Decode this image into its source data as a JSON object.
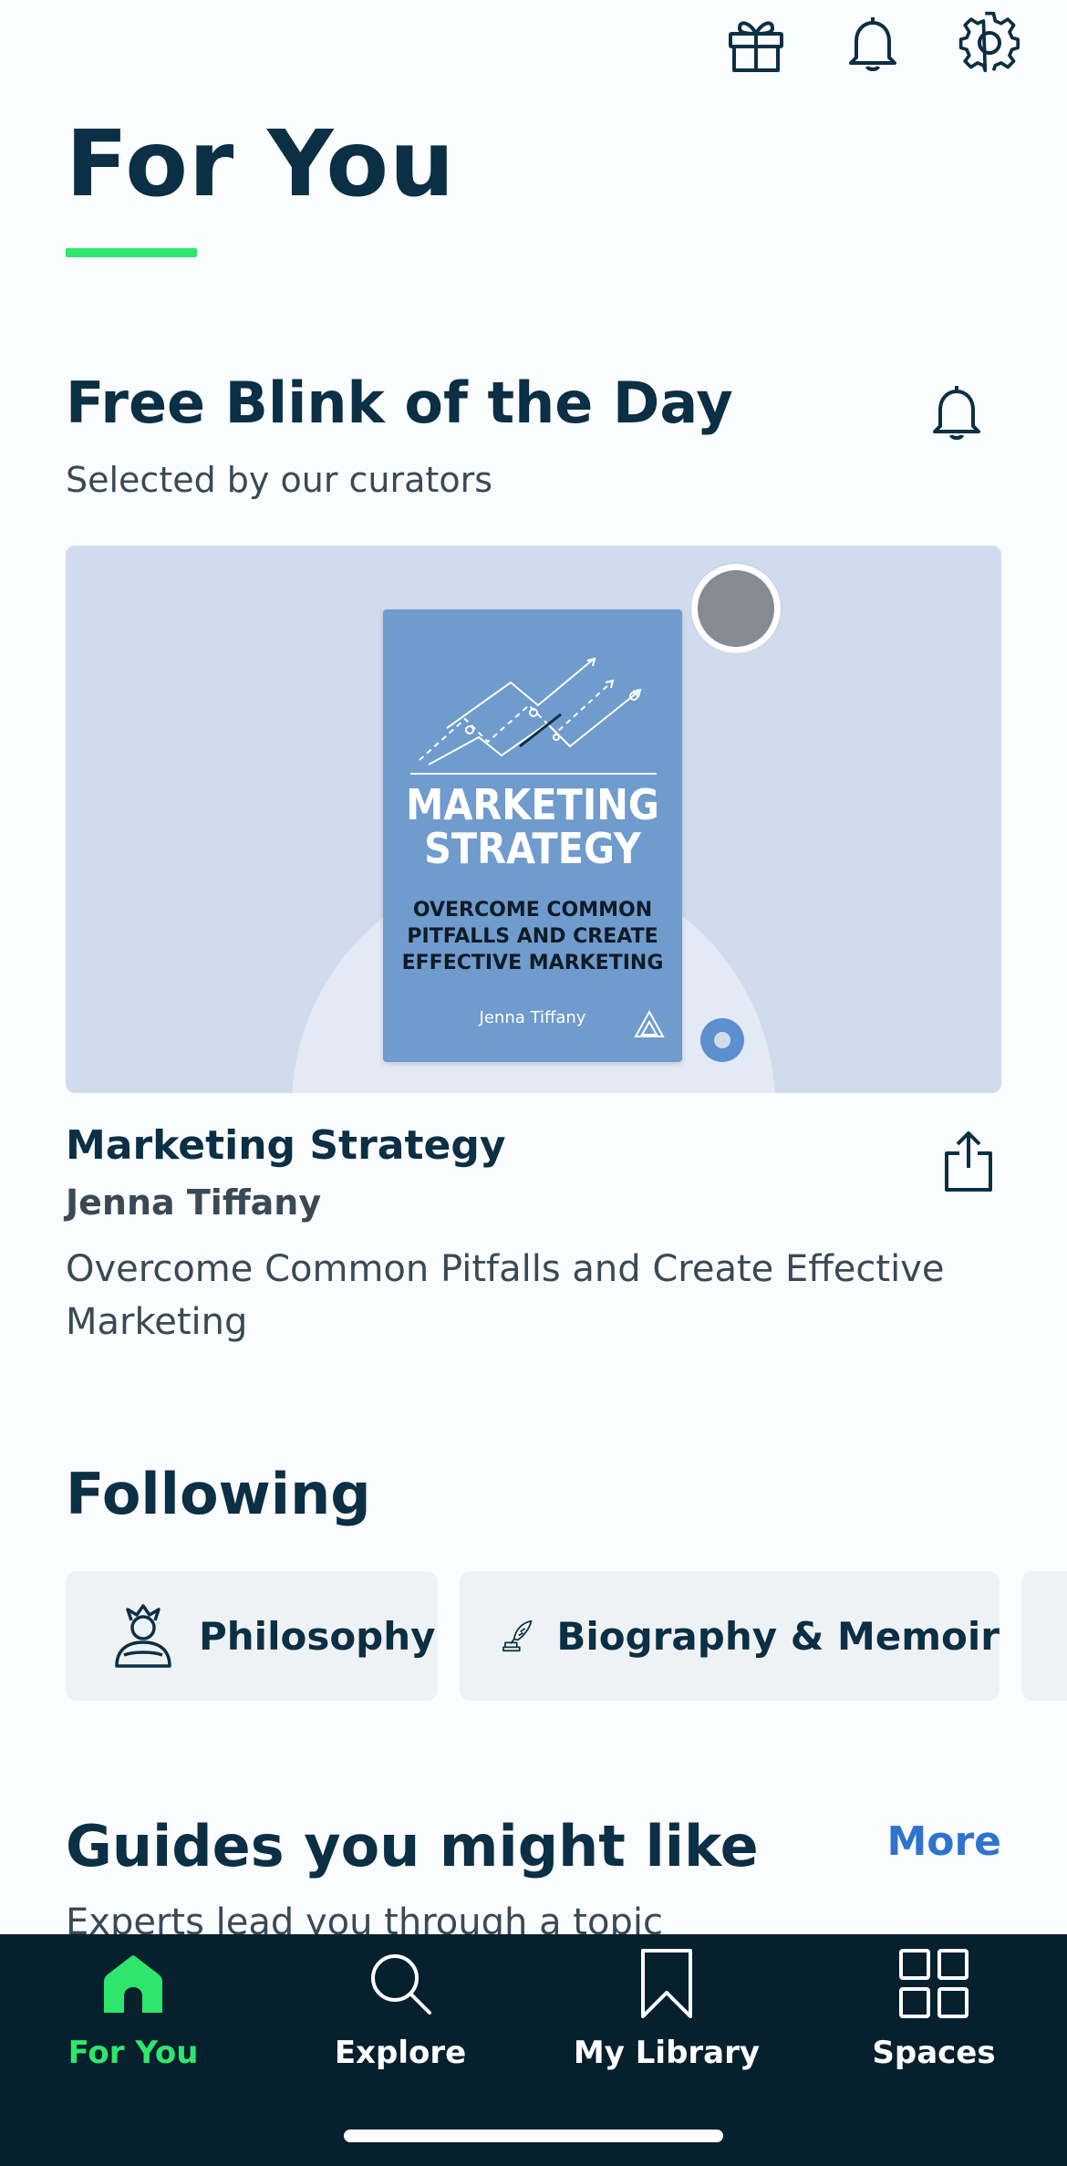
{
  "header": {
    "title": "For You",
    "icons": [
      "gift-icon",
      "bell-icon",
      "gear-icon"
    ]
  },
  "blink_of_day": {
    "title": "Free Blink of the Day",
    "subtitle": "Selected by our curators",
    "cover": {
      "title": "MARKETING STRATEGY",
      "subtitle": "OVERCOME COMMON PITFALLS AND CREATE EFFECTIVE MARKETING",
      "author": "Jenna Tiffany"
    },
    "book": {
      "title": "Marketing Strategy",
      "author": "Jenna Tiffany",
      "description": "Overcome Common Pitfalls and Create Effective Marketing"
    }
  },
  "following": {
    "title": "Following",
    "chips": [
      {
        "label": "Philosophy",
        "icon": "philosophy-icon"
      },
      {
        "label": "Biography & Memoir",
        "icon": "quill-icon"
      }
    ]
  },
  "guides": {
    "title": "Guides you might like",
    "more_label": "More",
    "subtitle": "Experts lead you through a topic"
  },
  "tabbar": {
    "tabs": [
      {
        "label": "For You",
        "icon": "home-icon",
        "active": true
      },
      {
        "label": "Explore",
        "icon": "search-icon",
        "active": false
      },
      {
        "label": "My Library",
        "icon": "bookmark-icon",
        "active": false
      },
      {
        "label": "Spaces",
        "icon": "grid-icon",
        "active": false
      }
    ]
  },
  "colors": {
    "accent_green": "#2ee66b",
    "navy": "#0b2f44",
    "link_blue": "#2f73cf",
    "tabbar_bg": "#06202e"
  }
}
